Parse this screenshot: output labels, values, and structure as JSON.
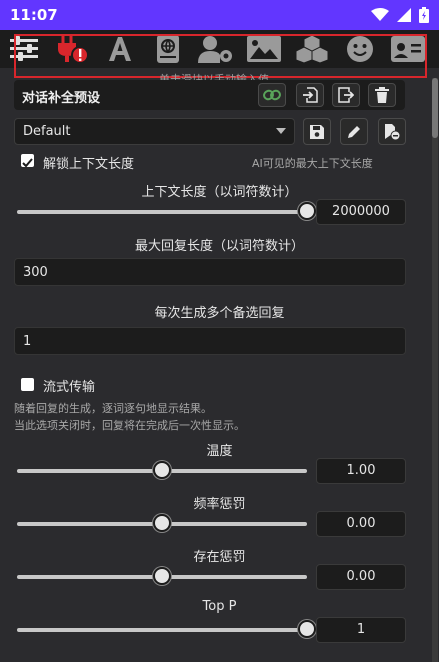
{
  "status_bar": {
    "time": "11:07"
  },
  "nav": {
    "icons": [
      "sliders-icon",
      "plug-alert-icon",
      "font-icon",
      "book-atlas-icon",
      "user-gear-icon",
      "image-icon",
      "cubes-icon",
      "face-smile-icon",
      "id-card-icon"
    ]
  },
  "hint": "单击滑块以手动输入值。",
  "preset": {
    "title": "对话补全预设",
    "selected": "Default"
  },
  "context": {
    "unlock_label": "解锁上下文长度",
    "unlock_checked": true,
    "unlock_note": "AI可见的最大上下文长度",
    "label": "上下文长度（以词符数计）",
    "value": "2000000",
    "fraction": 1.0
  },
  "max_response": {
    "label": "最大回复长度（以词符数计）",
    "value": "300"
  },
  "candidates": {
    "label": "每次生成多个备选回复",
    "value": "1"
  },
  "streaming": {
    "label": "流式传输",
    "checked": false,
    "desc1": "随着回复的生成，逐词逐句地显示结果。",
    "desc2": "当此选项关闭时，回复将在完成后一次性显示。"
  },
  "temperature": {
    "label": "温度",
    "value": "1.00",
    "fraction": 0.5
  },
  "frequency_penalty": {
    "label": "频率惩罚",
    "value": "0.00",
    "fraction": 0.5
  },
  "presence_penalty": {
    "label": "存在惩罚",
    "value": "0.00",
    "fraction": 0.5
  },
  "top_p": {
    "label": "Top P",
    "value": "1",
    "fraction": 1.0
  },
  "colors": {
    "status_bar": "#6236ff",
    "accent_red": "#d8262c",
    "panel": "#2b2b2e"
  }
}
